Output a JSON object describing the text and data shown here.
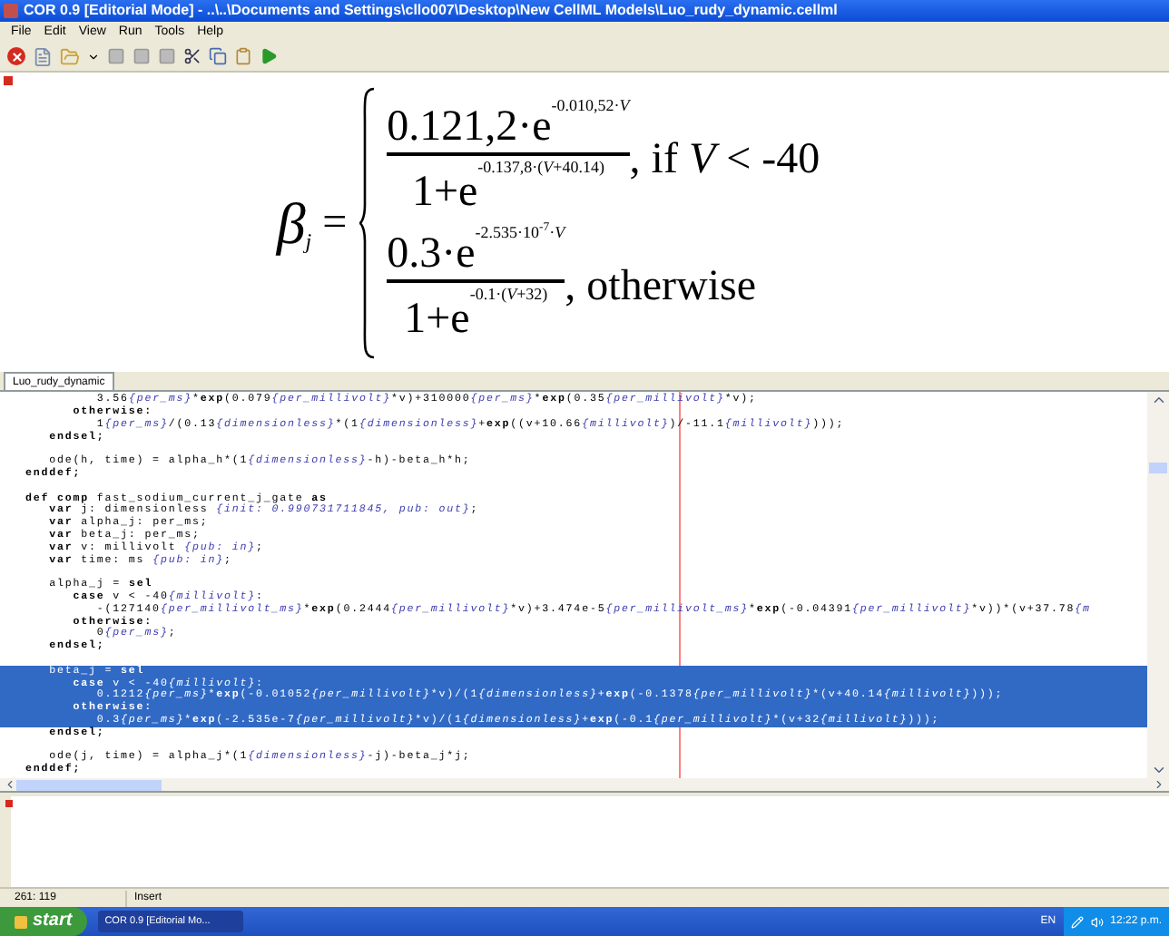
{
  "window": {
    "title": "COR 0.9 [Editorial Mode] - ..\\..\\Documents and Settings\\cllo007\\Desktop\\New CellML Models\\Luo_rudy_dynamic.cellml"
  },
  "menu": [
    "File",
    "Edit",
    "View",
    "Run",
    "Tools",
    "Help"
  ],
  "equation": {
    "symbol": "β",
    "subscript": "j",
    "relation": "=",
    "cases": [
      {
        "numerator": "0.121,2·e",
        "numerator_power": "-0.010,52·*V*",
        "denominator": "1+e",
        "denominator_power": "-0.137,8·(*V*+40.14)",
        "condition": ", if *V* < -40"
      },
      {
        "numerator": "0.3·e",
        "numerator_power": "-2.535·10$^{-7}$·*V*",
        "denominator": "1+e",
        "denominator_power": "-0.1·(*V*+32)",
        "condition": ", otherwise"
      }
    ]
  },
  "tabs": [
    {
      "label": "Luo_rudy_dynamic",
      "selected": true
    }
  ],
  "code_lines": [
    {
      "selected": false,
      "segments": [
        {
          "kind": "plain",
          "text": "         3.56"
        },
        {
          "kind": "unit",
          "text": "{per_ms}"
        },
        {
          "kind": "plain",
          "text": "*"
        },
        {
          "kind": "keyword",
          "text": "exp"
        },
        {
          "kind": "plain",
          "text": "(0.079"
        },
        {
          "kind": "unit",
          "text": "{per_millivolt}"
        },
        {
          "kind": "plain",
          "text": "*v)+310000"
        },
        {
          "kind": "unit",
          "text": "{per_ms}"
        },
        {
          "kind": "plain",
          "text": "*"
        },
        {
          "kind": "keyword",
          "text": "exp"
        },
        {
          "kind": "plain",
          "text": "(0.35"
        },
        {
          "kind": "unit",
          "text": "{per_millivolt}"
        },
        {
          "kind": "plain",
          "text": "*v);"
        }
      ]
    },
    {
      "selected": false,
      "segments": [
        {
          "kind": "keyword",
          "text": "      otherwise:"
        }
      ]
    },
    {
      "selected": false,
      "segments": [
        {
          "kind": "plain",
          "text": "         1"
        },
        {
          "kind": "unit",
          "text": "{per_ms}"
        },
        {
          "kind": "plain",
          "text": "/(0.13"
        },
        {
          "kind": "unit",
          "text": "{dimensionless}"
        },
        {
          "kind": "plain",
          "text": "*(1"
        },
        {
          "kind": "unit",
          "text": "{dimensionless}"
        },
        {
          "kind": "plain",
          "text": "+"
        },
        {
          "kind": "keyword",
          "text": "exp"
        },
        {
          "kind": "plain",
          "text": "((v+10.66"
        },
        {
          "kind": "unit",
          "text": "{millivolt}"
        },
        {
          "kind": "plain",
          "text": ")/-11.1"
        },
        {
          "kind": "unit",
          "text": "{millivolt}"
        },
        {
          "kind": "plain",
          "text": ")));"
        }
      ]
    },
    {
      "selected": false,
      "segments": [
        {
          "kind": "keyword",
          "text": "   endsel;"
        }
      ]
    },
    {
      "selected": false
    },
    {
      "selected": false,
      "segments": [
        {
          "kind": "plain",
          "text": "   ode(h, time) = alpha_h*(1"
        },
        {
          "kind": "unit",
          "text": "{dimensionless}"
        },
        {
          "kind": "plain",
          "text": "-h)-beta_h*h;"
        }
      ]
    },
    {
      "selected": false,
      "segments": [
        {
          "kind": "keyword",
          "text": "enddef;"
        }
      ]
    },
    {
      "selected": false
    },
    {
      "selected": false,
      "segments": [
        {
          "kind": "keyword",
          "text": "def comp"
        },
        {
          "kind": "plain",
          "text": " fast_sodium_current_j_gate "
        },
        {
          "kind": "keyword",
          "text": "as"
        }
      ]
    },
    {
      "selected": false,
      "segments": [
        {
          "kind": "keyword",
          "text": "   var"
        },
        {
          "kind": "plain",
          "text": " j: dimensionless "
        },
        {
          "kind": "unit",
          "text": "{init: 0.990731711845, pub: out}"
        },
        {
          "kind": "plain",
          "text": ";"
        }
      ]
    },
    {
      "selected": false,
      "segments": [
        {
          "kind": "keyword",
          "text": "   var"
        },
        {
          "kind": "plain",
          "text": " alpha_j: per_ms;"
        }
      ]
    },
    {
      "selected": false,
      "segments": [
        {
          "kind": "keyword",
          "text": "   var"
        },
        {
          "kind": "plain",
          "text": " beta_j: per_ms;"
        }
      ]
    },
    {
      "selected": false,
      "segments": [
        {
          "kind": "keyword",
          "text": "   var"
        },
        {
          "kind": "plain",
          "text": " v: millivolt "
        },
        {
          "kind": "unit",
          "text": "{pub: in}"
        },
        {
          "kind": "plain",
          "text": ";"
        }
      ]
    },
    {
      "selected": false,
      "segments": [
        {
          "kind": "keyword",
          "text": "   var"
        },
        {
          "kind": "plain",
          "text": " time: ms "
        },
        {
          "kind": "unit",
          "text": "{pub: in}"
        },
        {
          "kind": "plain",
          "text": ";"
        }
      ]
    },
    {
      "selected": false
    },
    {
      "selected": false,
      "segments": [
        {
          "kind": "plain",
          "text": "   alpha_j = "
        },
        {
          "kind": "keyword",
          "text": "sel"
        }
      ]
    },
    {
      "selected": false,
      "segments": [
        {
          "kind": "keyword",
          "text": "      case"
        },
        {
          "kind": "plain",
          "text": " v < -40"
        },
        {
          "kind": "unit",
          "text": "{millivolt}"
        },
        {
          "kind": "plain",
          "text": ":"
        }
      ]
    },
    {
      "selected": false,
      "segments": [
        {
          "kind": "plain",
          "text": "         -(127140"
        },
        {
          "kind": "unit",
          "text": "{per_millivolt_ms}"
        },
        {
          "kind": "plain",
          "text": "*"
        },
        {
          "kind": "keyword",
          "text": "exp"
        },
        {
          "kind": "plain",
          "text": "(0.2444"
        },
        {
          "kind": "unit",
          "text": "{per_millivolt}"
        },
        {
          "kind": "plain",
          "text": "*v)+3.474e-5"
        },
        {
          "kind": "unit",
          "text": "{per_millivolt_ms}"
        },
        {
          "kind": "plain",
          "text": "*"
        },
        {
          "kind": "keyword",
          "text": "exp"
        },
        {
          "kind": "plain",
          "text": "(-0.04391"
        },
        {
          "kind": "unit",
          "text": "{per_millivolt}"
        },
        {
          "kind": "plain",
          "text": "*v))*(v+37.78"
        },
        {
          "kind": "unit",
          "text": "{m"
        }
      ]
    },
    {
      "selected": false,
      "segments": [
        {
          "kind": "keyword",
          "text": "      otherwise:"
        }
      ]
    },
    {
      "selected": false,
      "segments": [
        {
          "kind": "plain",
          "text": "         0"
        },
        {
          "kind": "unit",
          "text": "{per_ms}"
        },
        {
          "kind": "plain",
          "text": ";"
        }
      ]
    },
    {
      "selected": false,
      "segments": [
        {
          "kind": "keyword",
          "text": "   endsel;"
        }
      ]
    },
    {
      "selected": false
    },
    {
      "selected": true,
      "segments": [
        {
          "kind": "plain",
          "text": "   beta_j = "
        },
        {
          "kind": "keyword",
          "text": "sel"
        }
      ]
    },
    {
      "selected": true,
      "segments": [
        {
          "kind": "keyword",
          "text": "      case"
        },
        {
          "kind": "plain",
          "text": " v < -40"
        },
        {
          "kind": "unit",
          "text": "{millivolt}"
        },
        {
          "kind": "plain",
          "text": ":"
        }
      ]
    },
    {
      "selected": true,
      "segments": [
        {
          "kind": "plain",
          "text": "         0.1212"
        },
        {
          "kind": "unit",
          "text": "{per_ms}"
        },
        {
          "kind": "plain",
          "text": "*"
        },
        {
          "kind": "keyword",
          "text": "exp"
        },
        {
          "kind": "plain",
          "text": "(-0.01052"
        },
        {
          "kind": "unit",
          "text": "{per_millivolt}"
        },
        {
          "kind": "plain",
          "text": "*v)/(1"
        },
        {
          "kind": "unit",
          "text": "{dimensionless}"
        },
        {
          "kind": "plain",
          "text": "+"
        },
        {
          "kind": "keyword",
          "text": "exp"
        },
        {
          "kind": "plain",
          "text": "(-0.1378"
        },
        {
          "kind": "unit",
          "text": "{per_millivolt}"
        },
        {
          "kind": "plain",
          "text": "*(v+40.14"
        },
        {
          "kind": "unit",
          "text": "{millivolt}"
        },
        {
          "kind": "plain",
          "text": ")));"
        }
      ]
    },
    {
      "selected": true,
      "segments": [
        {
          "kind": "keyword",
          "text": "      otherwise:"
        }
      ]
    },
    {
      "selected": true,
      "segments": [
        {
          "kind": "plain",
          "text": "         0.3"
        },
        {
          "kind": "unit",
          "text": "{per_ms}"
        },
        {
          "kind": "plain",
          "text": "*"
        },
        {
          "kind": "keyword",
          "text": "exp"
        },
        {
          "kind": "plain",
          "text": "(-2.535e-7"
        },
        {
          "kind": "unit",
          "text": "{per_millivolt}"
        },
        {
          "kind": "plain",
          "text": "*v)/(1"
        },
        {
          "kind": "unit",
          "text": "{dimensionless}"
        },
        {
          "kind": "plain",
          "text": "+"
        },
        {
          "kind": "keyword",
          "text": "exp"
        },
        {
          "kind": "plain",
          "text": "(-0.1"
        },
        {
          "kind": "unit",
          "text": "{per_millivolt}"
        },
        {
          "kind": "plain",
          "text": "*(v+32"
        },
        {
          "kind": "unit",
          "text": "{millivolt}"
        },
        {
          "kind": "plain",
          "text": ")));"
        }
      ]
    },
    {
      "selected": false,
      "segments": [
        {
          "kind": "keyword",
          "text": "   endsel;"
        }
      ]
    },
    {
      "selected": false
    },
    {
      "selected": false,
      "segments": [
        {
          "kind": "plain",
          "text": "   ode(j, time) = alpha_j*(1"
        },
        {
          "kind": "unit",
          "text": "{dimensionless}"
        },
        {
          "kind": "plain",
          "text": "-j)-beta_j*j;"
        }
      ]
    },
    {
      "selected": false,
      "segments": [
        {
          "kind": "keyword",
          "text": "enddef;"
        }
      ]
    }
  ],
  "status_bar": {
    "position": "261: 119",
    "mode": "Insert"
  },
  "taskbar": {
    "start": "start",
    "tasks": [
      {
        "label": "COR 0.9 [Editorial Mo...",
        "selected": true
      }
    ],
    "language": "EN",
    "clock": "12:22 p.m."
  }
}
